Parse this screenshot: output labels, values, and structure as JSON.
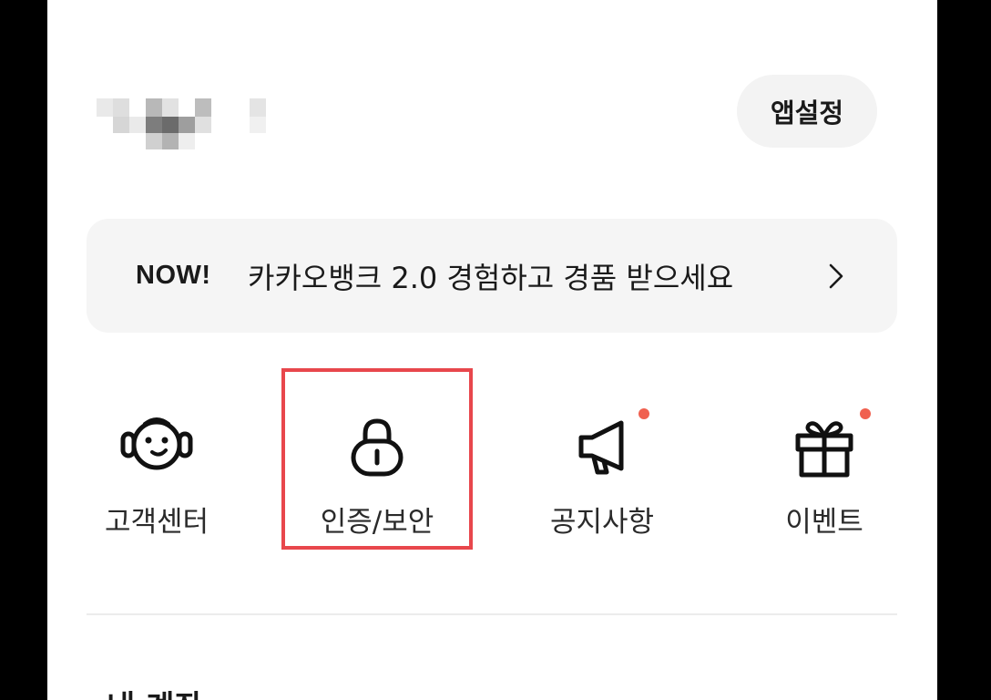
{
  "header": {
    "app_settings_label": "앱설정"
  },
  "banner": {
    "badge": "NOW!",
    "text": "카카오뱅크 2.0 경험하고 경품 받으세요"
  },
  "shortcuts": [
    {
      "label": "고객센터",
      "icon": "headset-face-icon",
      "has_new": false
    },
    {
      "label": "인증/보안",
      "icon": "lock-icon",
      "has_new": false,
      "highlighted": true
    },
    {
      "label": "공지사항",
      "icon": "megaphone-icon",
      "has_new": true
    },
    {
      "label": "이벤트",
      "icon": "gift-icon",
      "has_new": true
    }
  ],
  "next_section": {
    "title": "내 계좌"
  },
  "colors": {
    "background": "#ffffff",
    "pill": "#f3f3f3",
    "banner_bg": "#f5f5f5",
    "new_dot": "#f0604f",
    "highlight": "#e8474c"
  }
}
